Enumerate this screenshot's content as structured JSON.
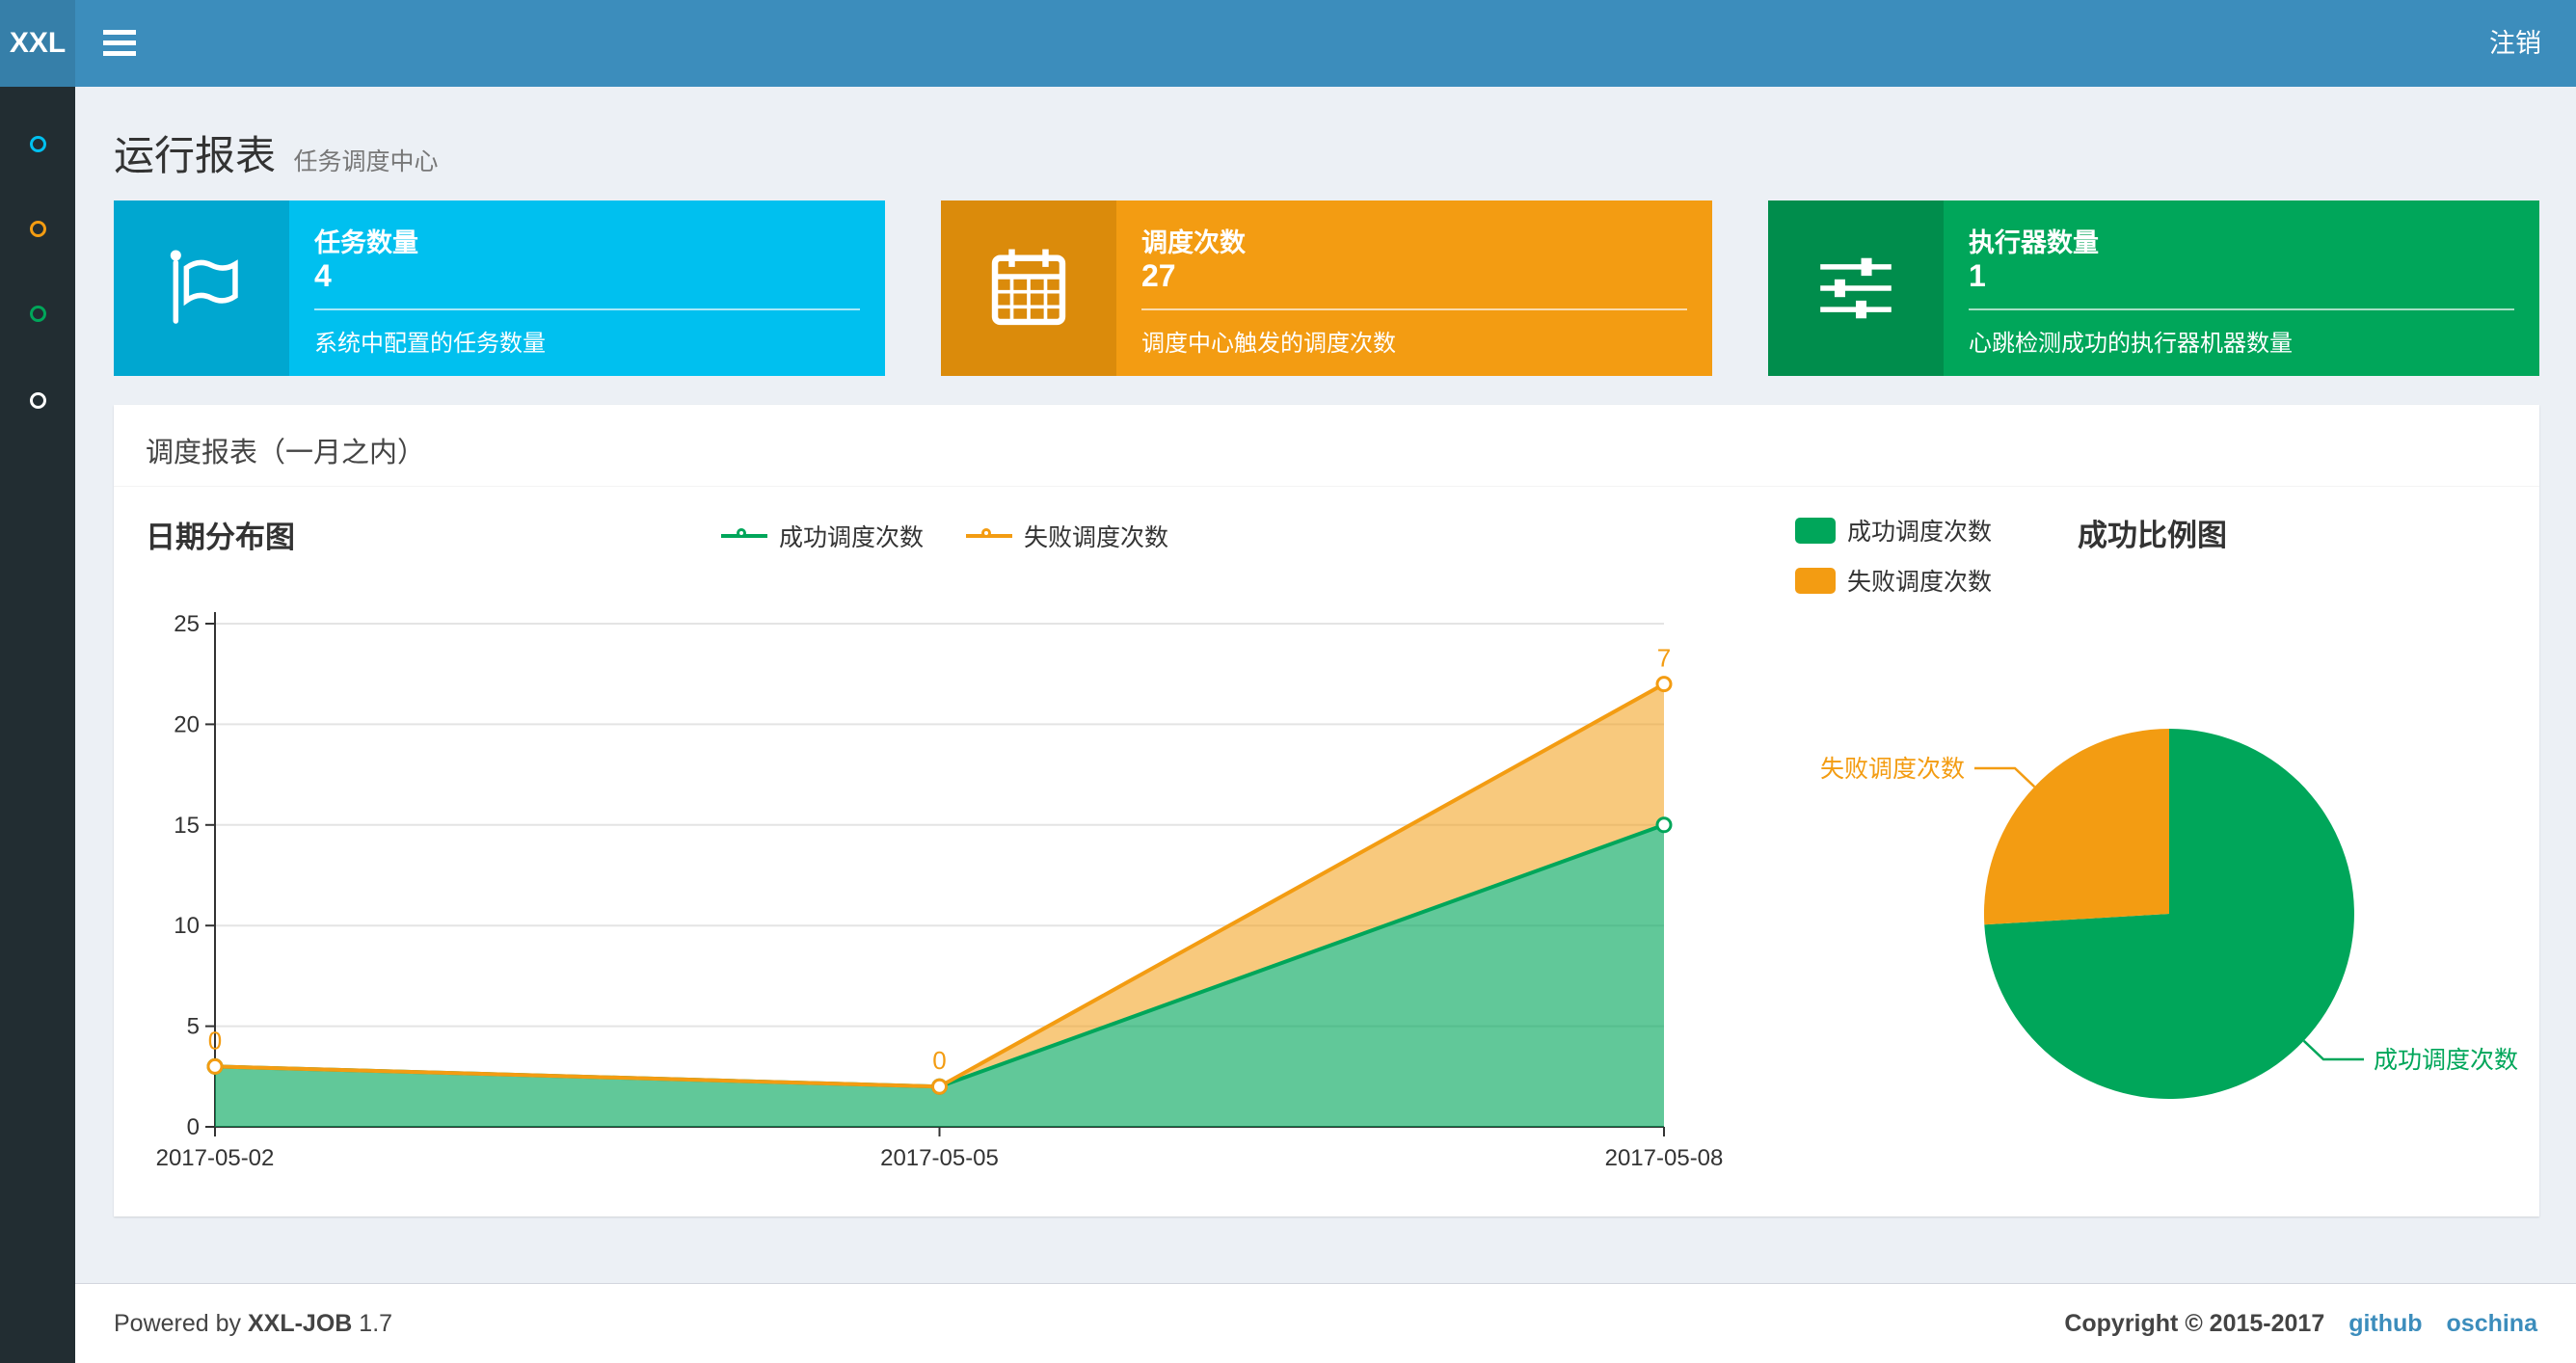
{
  "navbar": {
    "logo": "XXL",
    "logout_label": "注销"
  },
  "sidebar": {
    "items": [
      {
        "icon": "circle-icon",
        "color": "#00c0ef"
      },
      {
        "icon": "circle-icon",
        "color": "#f39c12"
      },
      {
        "icon": "circle-icon",
        "color": "#00a65a"
      },
      {
        "icon": "circle-icon",
        "color": "#ffffff"
      }
    ]
  },
  "page_header": {
    "title": "运行报表",
    "subtitle": "任务调度中心"
  },
  "info_boxes": [
    {
      "label": "任务数量",
      "value": "4",
      "description": "系统中配置的任务数量",
      "bg_color": "#00c0ef",
      "icon_bg_color": "#00a7d0",
      "icon": "flag-icon"
    },
    {
      "label": "调度次数",
      "value": "27",
      "description": "调度中心触发的调度次数",
      "bg_color": "#f39c12",
      "icon_bg_color": "#db8b0b",
      "icon": "calendar-icon"
    },
    {
      "label": "执行器数量",
      "value": "1",
      "description": "心跳检测成功的执行器机器数量",
      "bg_color": "#00a65a",
      "icon_bg_color": "#008d4c",
      "icon": "sliders-icon"
    }
  ],
  "panel": {
    "title": "调度报表（一月之内）"
  },
  "chart_data": [
    {
      "type": "area",
      "title": "日期分布图",
      "x": [
        "2017-05-02",
        "2017-05-05",
        "2017-05-08"
      ],
      "series": [
        {
          "name": "成功调度次数",
          "color": "#00a65a",
          "values": [
            3,
            2,
            15
          ]
        },
        {
          "name": "失败调度次数",
          "color": "#f39c12",
          "values": [
            0,
            0,
            7
          ]
        }
      ],
      "stacked": true,
      "ylim": [
        0,
        25
      ],
      "yticks": [
        0,
        5,
        10,
        15,
        20,
        25
      ],
      "grid": true,
      "legend_position": "top-center",
      "point_labels_series": "失败调度次数",
      "point_labels": [
        0,
        0,
        7
      ]
    },
    {
      "type": "pie",
      "title": "成功比例图",
      "slices": [
        {
          "name": "成功调度次数",
          "color": "#00a65a",
          "value": 20
        },
        {
          "name": "失败调度次数",
          "color": "#f39c12",
          "value": 7
        }
      ],
      "legend_position": "top-left"
    }
  ],
  "footer": {
    "powered_prefix": "Powered by",
    "product": "XXL-JOB",
    "version": "1.7",
    "copyright": "Copyright © 2015-2017",
    "links": [
      {
        "label": "github"
      },
      {
        "label": "oschina"
      }
    ],
    "link_color": "#3c8dbc"
  },
  "theme": {
    "navbar_color": "#3c8dbc",
    "logo_bg": "#367fa9",
    "sidebar_bg": "#222d32",
    "content_bg": "#ecf0f5"
  }
}
